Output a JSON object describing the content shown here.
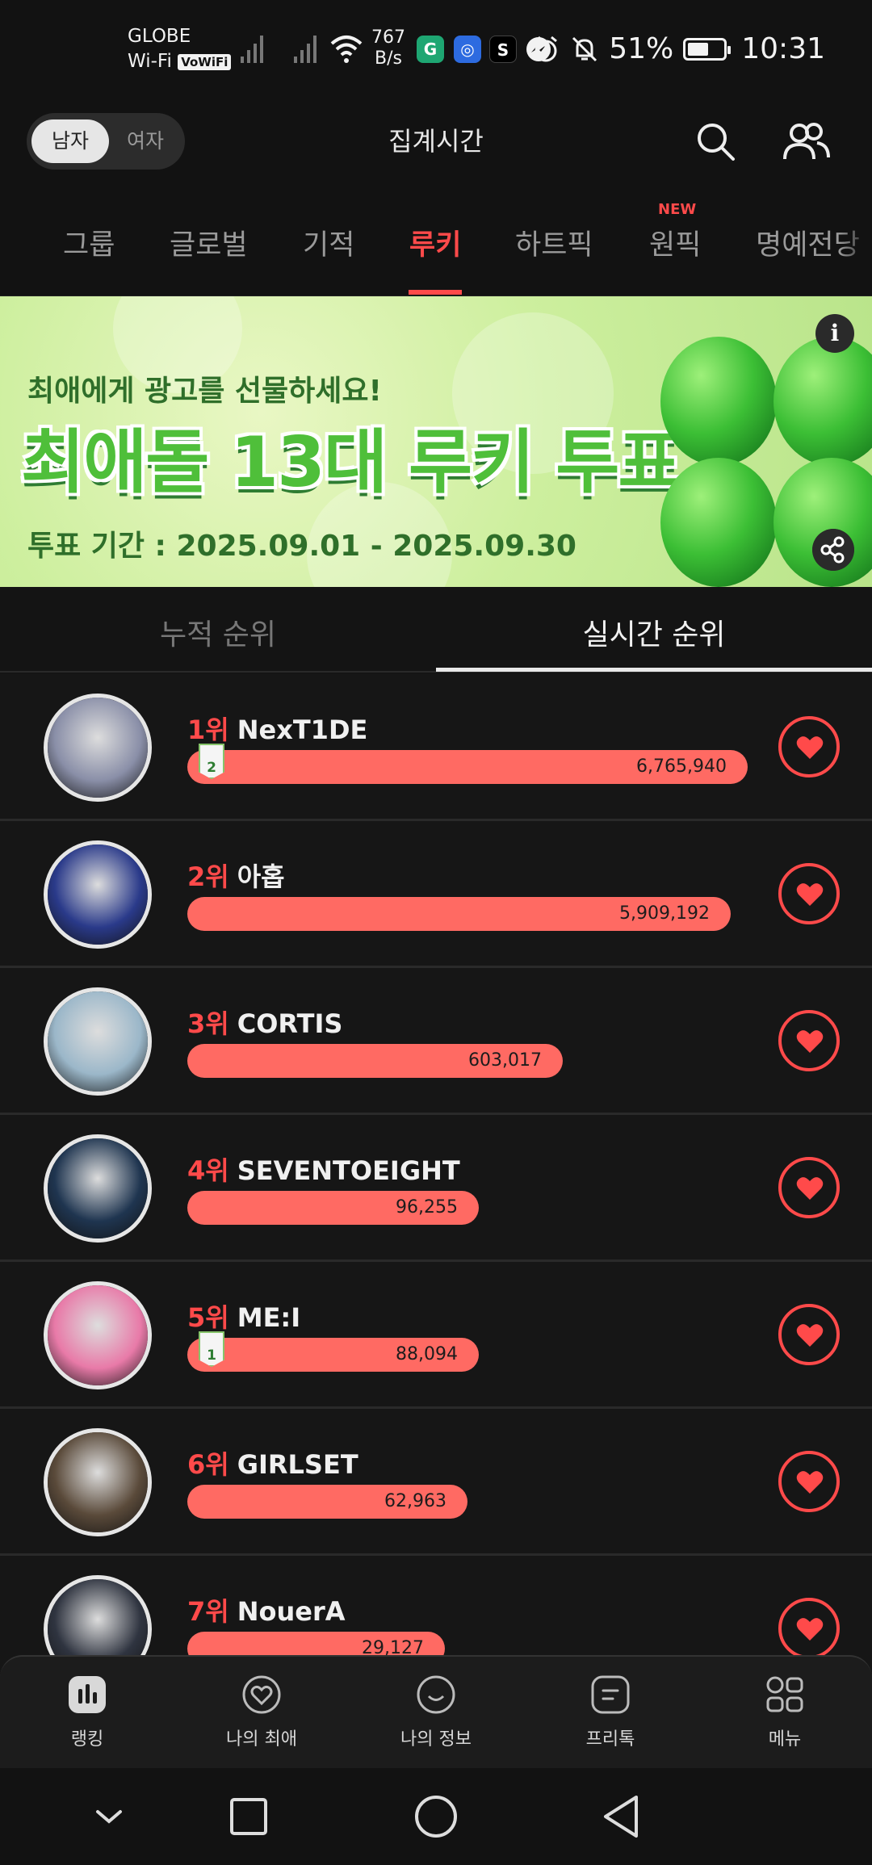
{
  "status_bar": {
    "carrier_line1": "GLOBE",
    "carrier_line2": "Wi-Fi",
    "vowifi": "VoWiFi",
    "net_speed_value": "767",
    "net_speed_unit": "B/s",
    "app_s_label": "S",
    "battery": "51%",
    "time": "10:31"
  },
  "header": {
    "gender_selected": "남자",
    "gender_other": "여자",
    "title": "집계시간"
  },
  "tabs": [
    {
      "label": "그룹"
    },
    {
      "label": "글로벌"
    },
    {
      "label": "기적"
    },
    {
      "label": "루키",
      "active": true
    },
    {
      "label": "하트픽"
    },
    {
      "label": "원픽",
      "badge": "NEW"
    },
    {
      "label": "명예전당"
    }
  ],
  "banner": {
    "subtitle": "최애에게 광고를 선물하세요!",
    "title": "최애돌 13대 루키 투표",
    "period": "투표 기간 : 2025.09.01 - 2025.09.30",
    "info_glyph": "i"
  },
  "subtabs": {
    "cumulative": "누적 순위",
    "realtime": "실시간 순위"
  },
  "ranking": [
    {
      "rank": "1위",
      "name": "NexT1DE",
      "votes": "6,765,940",
      "vote_value": 6765940,
      "streak": "2",
      "bar_fraction": 1.0,
      "color": "#8a8fa8"
    },
    {
      "rank": "2위",
      "name": "아홉",
      "votes": "5,909,192",
      "vote_value": 5909192,
      "streak": null,
      "bar_fraction": 0.97,
      "color": "#2a3a8a"
    },
    {
      "rank": "3위",
      "name": "CORTIS",
      "votes": "603,017",
      "vote_value": 603017,
      "streak": null,
      "bar_fraction": 0.67,
      "color": "#9bb7c9"
    },
    {
      "rank": "4위",
      "name": "SEVENTOEIGHT",
      "votes": "96,255",
      "vote_value": 96255,
      "streak": null,
      "bar_fraction": 0.52,
      "color": "#1f3550"
    },
    {
      "rank": "5위",
      "name": "ME:I",
      "votes": "88,094",
      "vote_value": 88094,
      "streak": "1",
      "bar_fraction": 0.52,
      "color": "#e87aa8"
    },
    {
      "rank": "6위",
      "name": "GIRLSET",
      "votes": "62,963",
      "vote_value": 62963,
      "streak": null,
      "bar_fraction": 0.5,
      "color": "#5a4a3a"
    },
    {
      "rank": "7위",
      "name": "NouerA",
      "votes": "29,127",
      "vote_value": 29127,
      "streak": null,
      "bar_fraction": 0.46,
      "color": "#2f3440"
    }
  ],
  "bottom_nav": [
    {
      "label": "랭킹",
      "icon": "ranking-icon",
      "active": true
    },
    {
      "label": "나의 최애",
      "icon": "heart-outline-icon"
    },
    {
      "label": "나의 정보",
      "icon": "smile-icon"
    },
    {
      "label": "프리톡",
      "icon": "chat-icon"
    },
    {
      "label": "메뉴",
      "icon": "menu-grid-icon"
    }
  ],
  "colors": {
    "accent": "#ff4a4a",
    "bar": "#ff6a63",
    "background": "#141414"
  }
}
